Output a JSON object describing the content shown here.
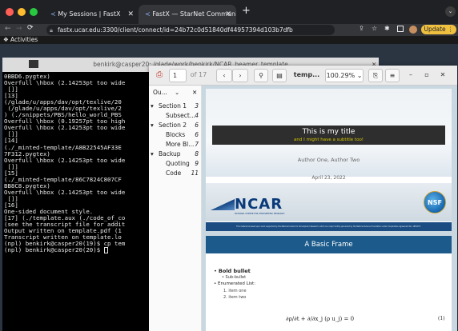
{
  "browser": {
    "tabs": [
      {
        "label": "My Sessions | FastX"
      },
      {
        "label": "FastX — StarNet Communicati"
      }
    ],
    "url": "fastx.ucar.edu:3300/client/connect/id=24b72c0d51840df44957394d103b7dfb",
    "update_label": "Update",
    "colors": {
      "close": "#ff5f57",
      "min": "#febc2e",
      "max": "#28c840",
      "update": "#f0c040"
    }
  },
  "desktop": {
    "activities_label": "Activities"
  },
  "terminal": {
    "title": "benkirk@casper20: /glade/work/benkirk/NCAR_beamer_template",
    "lines": [
      "0BBD6.pygtex)",
      "Overfull \\hbox (2.14253pt too wide",
      " []]",
      "[13]",
      "(/glade/u/apps/dav/opt/texlive/20",
      " (/glade/u/apps/dav/opt/texlive/2",
      ") (./snippets/PBS/hello_world_PBS",
      "Overfull \\hbox (0.19257pt too high",
      "",
      "Overfull \\hbox (2.14253pt too wide",
      " []]",
      "[14]",
      "(./_minted-template/A8B22545AF33E",
      "7F312.pygtex)",
      "Overfull \\hbox (2.14253pt too wide",
      " []]",
      "[15]",
      "(./_minted-template/86C7824C807CF",
      "BB8C8.pygtex)",
      "Overfull \\hbox (2.14253pt too wide",
      " []]",
      "[16]",
      "One-sided document style.",
      "[17] (./template.aux (./code_of_co",
      "(see the transcript file for addit",
      "Output written on template.pdf (1",
      "Transcript written on template.lo",
      "(npl) benkirk@casper20(19)$ cp tem",
      "(npl) benkirk@casper20(20)$ "
    ]
  },
  "pdf_viewer": {
    "page_current": "1",
    "page_total": "of 17",
    "filename": "temp...",
    "zoom": "100.29%",
    "outline_label": "Ou...",
    "outline": [
      {
        "label": "Section 1",
        "page": "3",
        "level": 0
      },
      {
        "label": "Subsect...",
        "page": "4",
        "level": 1
      },
      {
        "label": "Section 2",
        "page": "6",
        "level": 0
      },
      {
        "label": "Blocks",
        "page": "6",
        "level": 1
      },
      {
        "label": "More Bl...",
        "page": "7",
        "level": 1
      },
      {
        "label": "Backup",
        "page": "8",
        "level": 0
      },
      {
        "label": "Quoting",
        "page": "9",
        "level": 1
      },
      {
        "label": "Code",
        "page": "11",
        "level": 1
      }
    ]
  },
  "slide1": {
    "title": "This is my title",
    "subtitle": "and I might have a subtitle too!",
    "authors": "Author One, Author Two",
    "date": "April 23, 2022",
    "logo_text": "NCAR",
    "logo_sub": "NATIONAL CENTER FOR ATMOSPHERIC RESEARCH",
    "nsf_text": "NSF",
    "footer": "This material is based upon work supported by the National Center for Atmospheric Research, which is a major facility sponsored by the National Science Foundation under Cooperative Agreement No. 1852977."
  },
  "slide2": {
    "title": "A Basic Frame",
    "bold_bullet": "Bold bullet",
    "sub_bullet": "Sub-bullet",
    "enum_label": "Enumerated List:",
    "items": [
      "1. item one",
      "2. item two"
    ],
    "equation": "∂ρ/∂t + ∂/∂x_j (ρ u_j) = 0",
    "eq_number": "(1)"
  }
}
